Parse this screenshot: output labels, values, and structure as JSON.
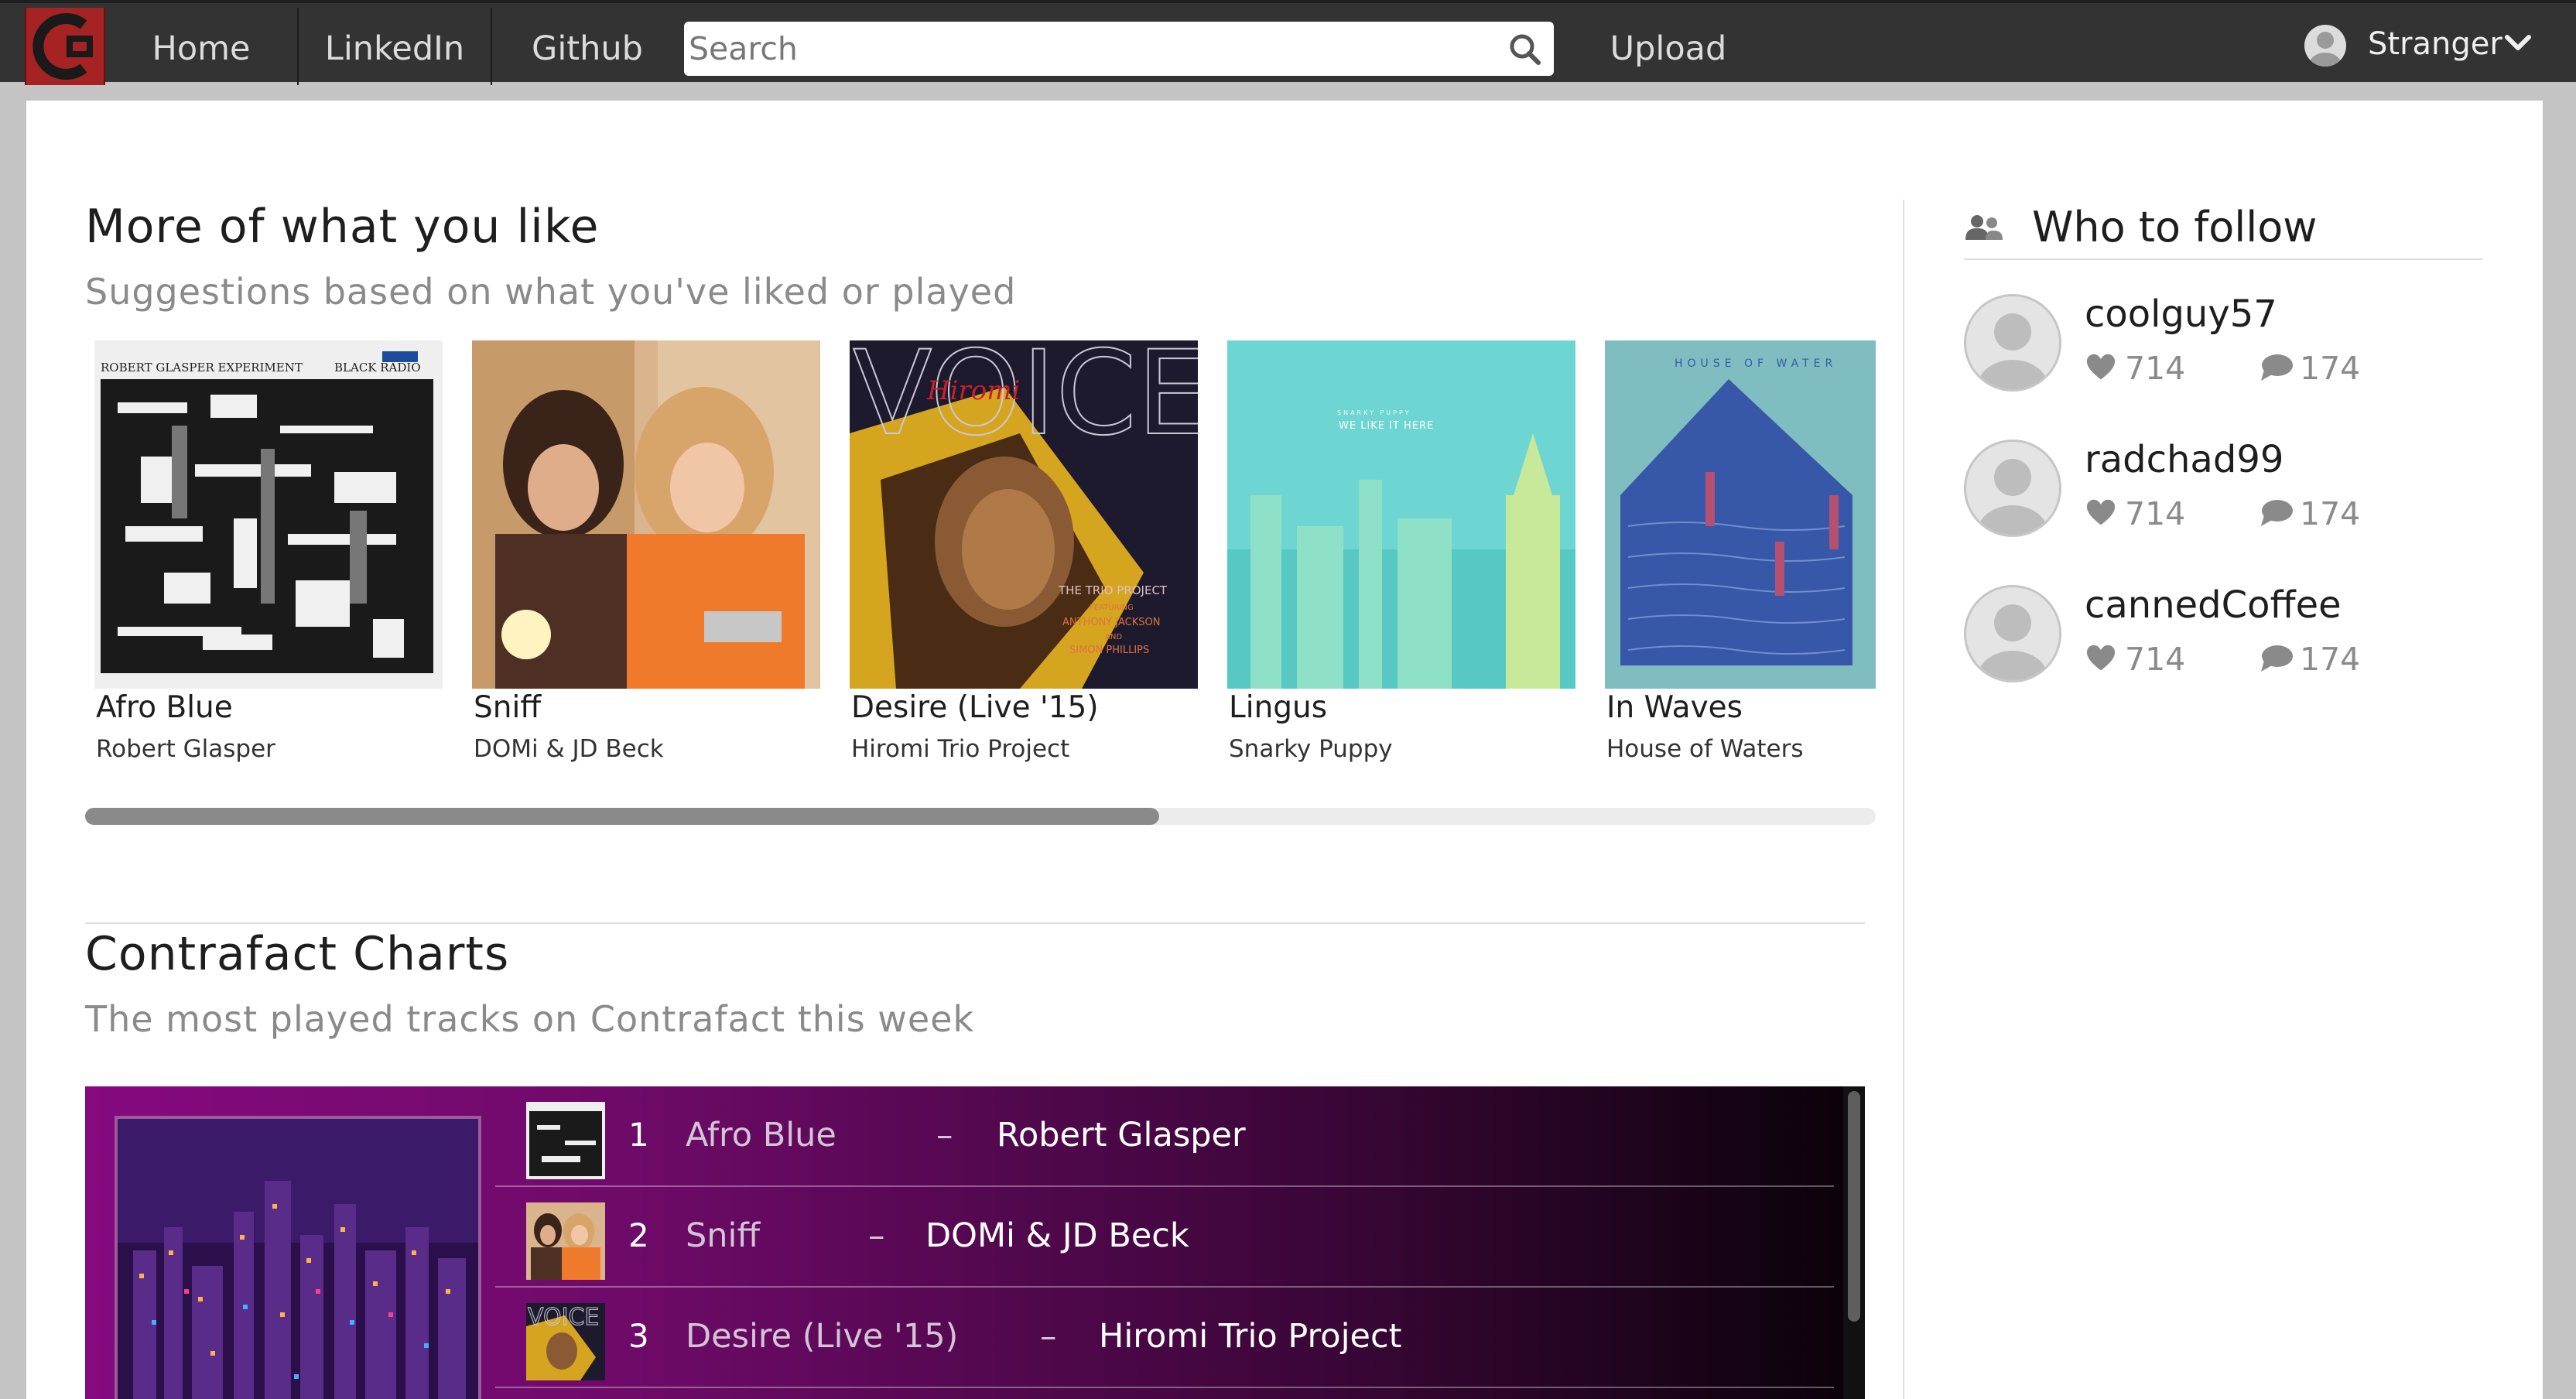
{
  "nav": {
    "logo_letter": "C",
    "links": [
      "Home",
      "LinkedIn",
      "Github"
    ],
    "search_placeholder": "Search",
    "upload_label": "Upload",
    "user_name": "Stranger"
  },
  "colors": {
    "nav_bg": "#333333",
    "logo_bg": "#a52322",
    "chart_gradient_start": "#86097f",
    "chart_gradient_end": "#0a0209"
  },
  "suggestions": {
    "title": "More of what you like",
    "subtitle": "Suggestions based on what you've liked or played",
    "scroll_position": 0.6,
    "albums": [
      {
        "title": "Afro Blue",
        "artist": "Robert Glasper",
        "cover_text_left": "ROBERT GLASPER EXPERIMENT",
        "cover_text_right": "BLACK RADIO"
      },
      {
        "title": "Sniff",
        "artist": "DOMi & JD Beck"
      },
      {
        "title": "Desire (Live '15)",
        "artist": "Hiromi Trio Project",
        "cover_word": "VOICE",
        "cover_script": "Hiromi",
        "cover_credits": [
          "THE TRIO PROJECT",
          "FEATURING",
          "ANTHONY JACKSON",
          "AND",
          "SIMON PHILLIPS"
        ]
      },
      {
        "title": "Lingus",
        "artist": "Snarky Puppy",
        "cover_small": "SNARKY PUPPY",
        "cover_text": "WE LIKE IT HERE"
      },
      {
        "title": "In Waves",
        "artist": "House of Waters",
        "cover_text": "HOUSE OF WATER"
      }
    ]
  },
  "charts": {
    "title": "Contrafact Charts",
    "subtitle": "The most played tracks on Contrafact this week",
    "separator": "–",
    "tracks": [
      {
        "rank": "1",
        "title": "Afro Blue",
        "artist": "Robert Glasper"
      },
      {
        "rank": "2",
        "title": "Sniff",
        "artist": "DOMi & JD Beck"
      },
      {
        "rank": "3",
        "title": "Desire (Live '15)",
        "artist": "Hiromi Trio Project"
      }
    ]
  },
  "follow": {
    "title": "Who to follow",
    "users": [
      {
        "name": "coolguy57",
        "likes": "714",
        "comments": "174"
      },
      {
        "name": "radchad99",
        "likes": "714",
        "comments": "174"
      },
      {
        "name": "cannedCoffee",
        "likes": "714",
        "comments": "174"
      }
    ]
  }
}
